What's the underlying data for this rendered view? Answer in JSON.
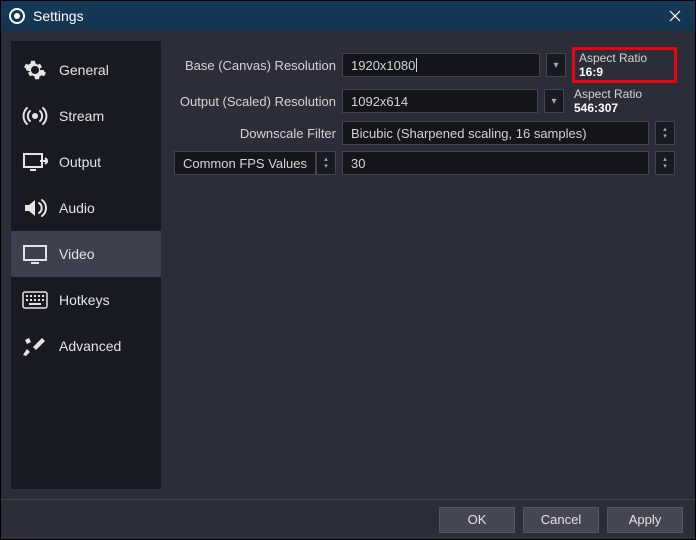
{
  "window": {
    "title": "Settings"
  },
  "sidebar": {
    "items": [
      {
        "label": "General",
        "icon": "gear-icon"
      },
      {
        "label": "Stream",
        "icon": "stream-icon"
      },
      {
        "label": "Output",
        "icon": "output-icon"
      },
      {
        "label": "Audio",
        "icon": "audio-icon"
      },
      {
        "label": "Video",
        "icon": "video-icon"
      },
      {
        "label": "Hotkeys",
        "icon": "hotkeys-icon"
      },
      {
        "label": "Advanced",
        "icon": "advanced-icon"
      }
    ],
    "active_index": 4
  },
  "video": {
    "base_label": "Base (Canvas) Resolution",
    "base_value": "1920x1080",
    "base_aspect_label": "Aspect Ratio",
    "base_aspect_value": "16:9",
    "output_label": "Output (Scaled) Resolution",
    "output_value": "1092x614",
    "output_aspect_label": "Aspect Ratio",
    "output_aspect_value": "546:307",
    "downscale_label": "Downscale Filter",
    "downscale_value": "Bicubic (Sharpened scaling, 16 samples)",
    "fps_label": "Common FPS Values",
    "fps_value": "30"
  },
  "footer": {
    "ok": "OK",
    "cancel": "Cancel",
    "apply": "Apply"
  }
}
